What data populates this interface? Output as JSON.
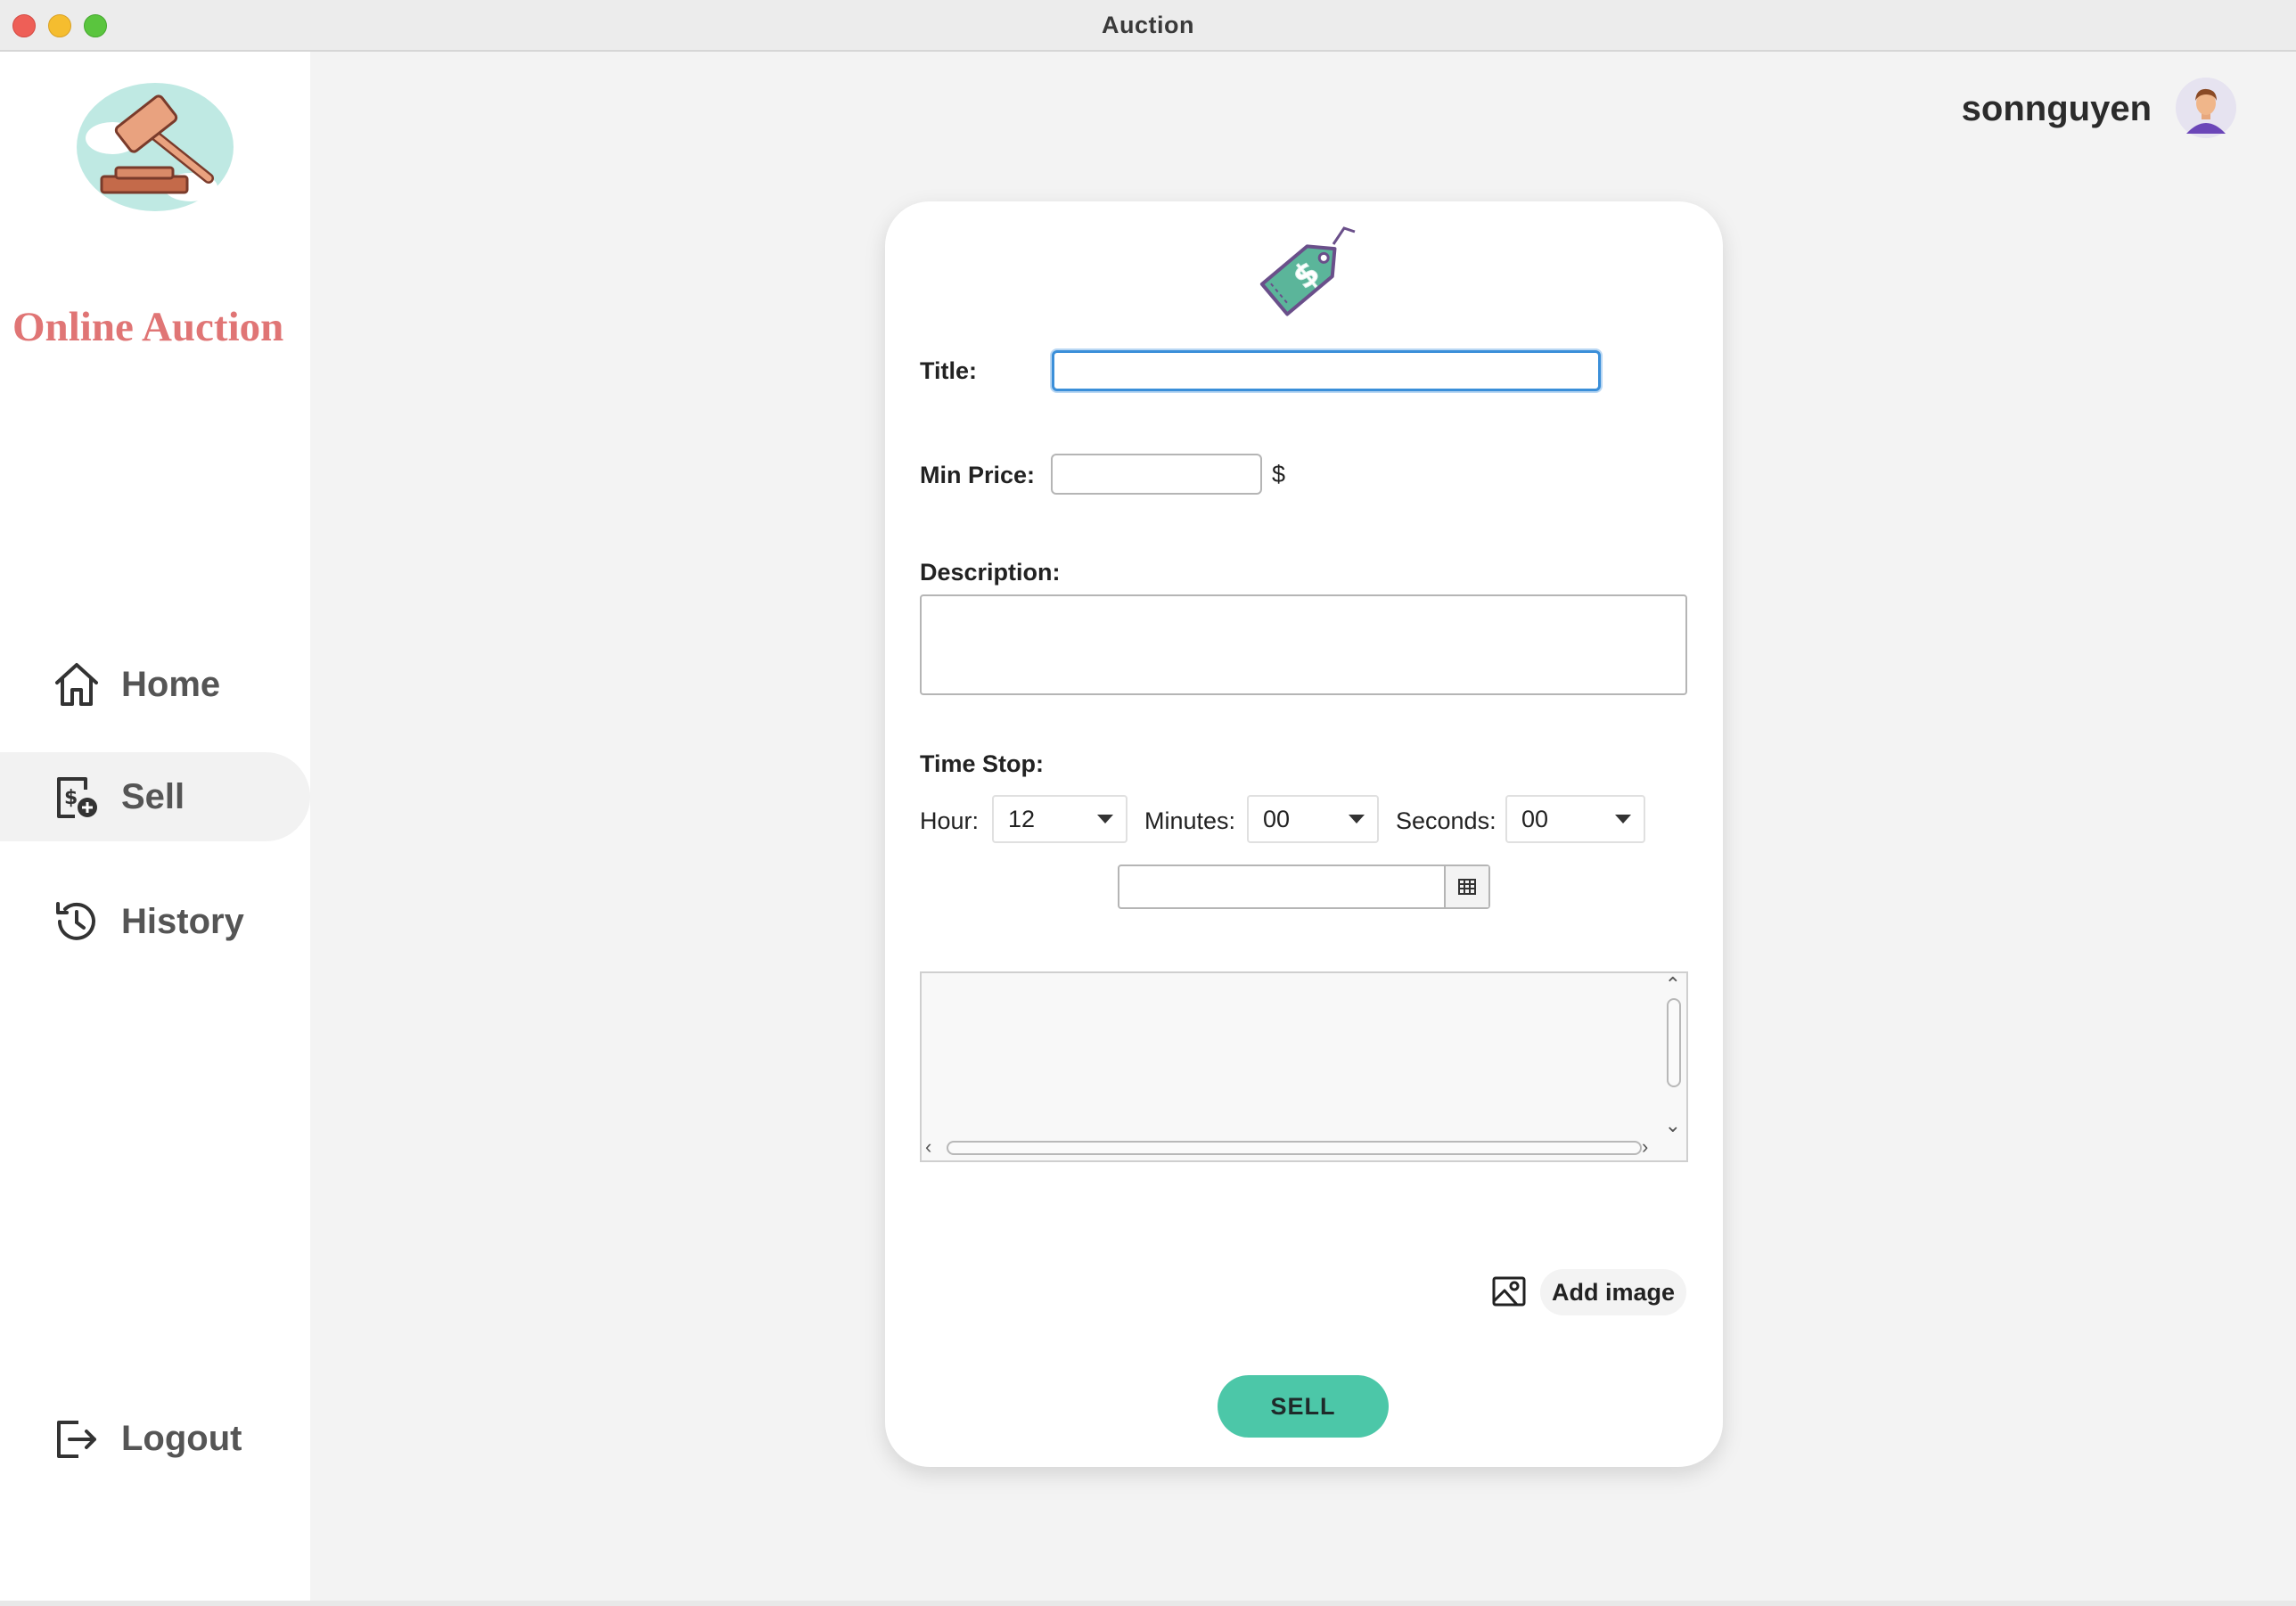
{
  "window": {
    "title": "Auction"
  },
  "sidebar": {
    "brand": "Online Auction",
    "items": [
      {
        "label": "Home",
        "icon": "home-icon",
        "active": false
      },
      {
        "label": "Sell",
        "icon": "sell-document-icon",
        "active": true
      },
      {
        "label": "History",
        "icon": "history-icon",
        "active": false
      }
    ],
    "logout": {
      "label": "Logout",
      "icon": "logout-icon"
    }
  },
  "header": {
    "username": "sonnguyen",
    "avatar_icon": "user-avatar-icon"
  },
  "form": {
    "title_label": "Title:",
    "title_value": "",
    "min_price_label": "Min Price:",
    "min_price_value": "",
    "currency": "$",
    "description_label": "Description:",
    "description_value": "",
    "time_stop_label": "Time Stop:",
    "hour_label": "Hour:",
    "hour_value": "12",
    "minutes_label": "Minutes:",
    "minutes_value": "00",
    "seconds_label": "Seconds:",
    "seconds_value": "00",
    "date_value": "",
    "add_image_label": "Add image",
    "sell_label": "SELL"
  },
  "colors": {
    "accent": "#4cc7a8",
    "brand": "#e07575",
    "focus": "#3b8fd9"
  }
}
